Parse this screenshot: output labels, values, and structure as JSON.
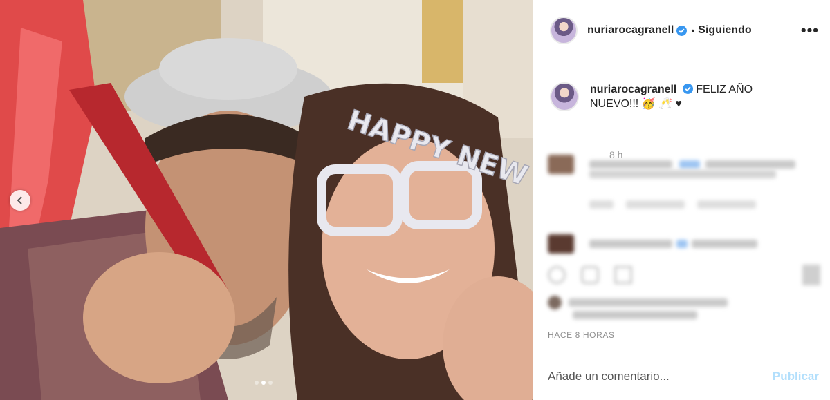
{
  "post": {
    "username": "nuriarocagranell",
    "follow_separator": "•",
    "follow_label": "Siguiendo",
    "more_label": "•••",
    "caption_text": "FELIZ AÑO NUEVO!!! 🥳 🥂 ♥",
    "caption_age": "8 h",
    "timestamp": "HACE 8 HORAS"
  },
  "photo": {
    "glasses_text": "HAPPY NEW YEAR",
    "carousel_count": 3,
    "carousel_active": 2
  },
  "composer": {
    "placeholder": "Añade un comentario...",
    "publish_label": "Publicar"
  },
  "colors": {
    "verified": "#3897f0",
    "publish_disabled": "#b2dffc"
  },
  "icons": {
    "prev": "chevron-left-icon",
    "verified": "verified-badge-icon",
    "more": "more-options-icon"
  }
}
